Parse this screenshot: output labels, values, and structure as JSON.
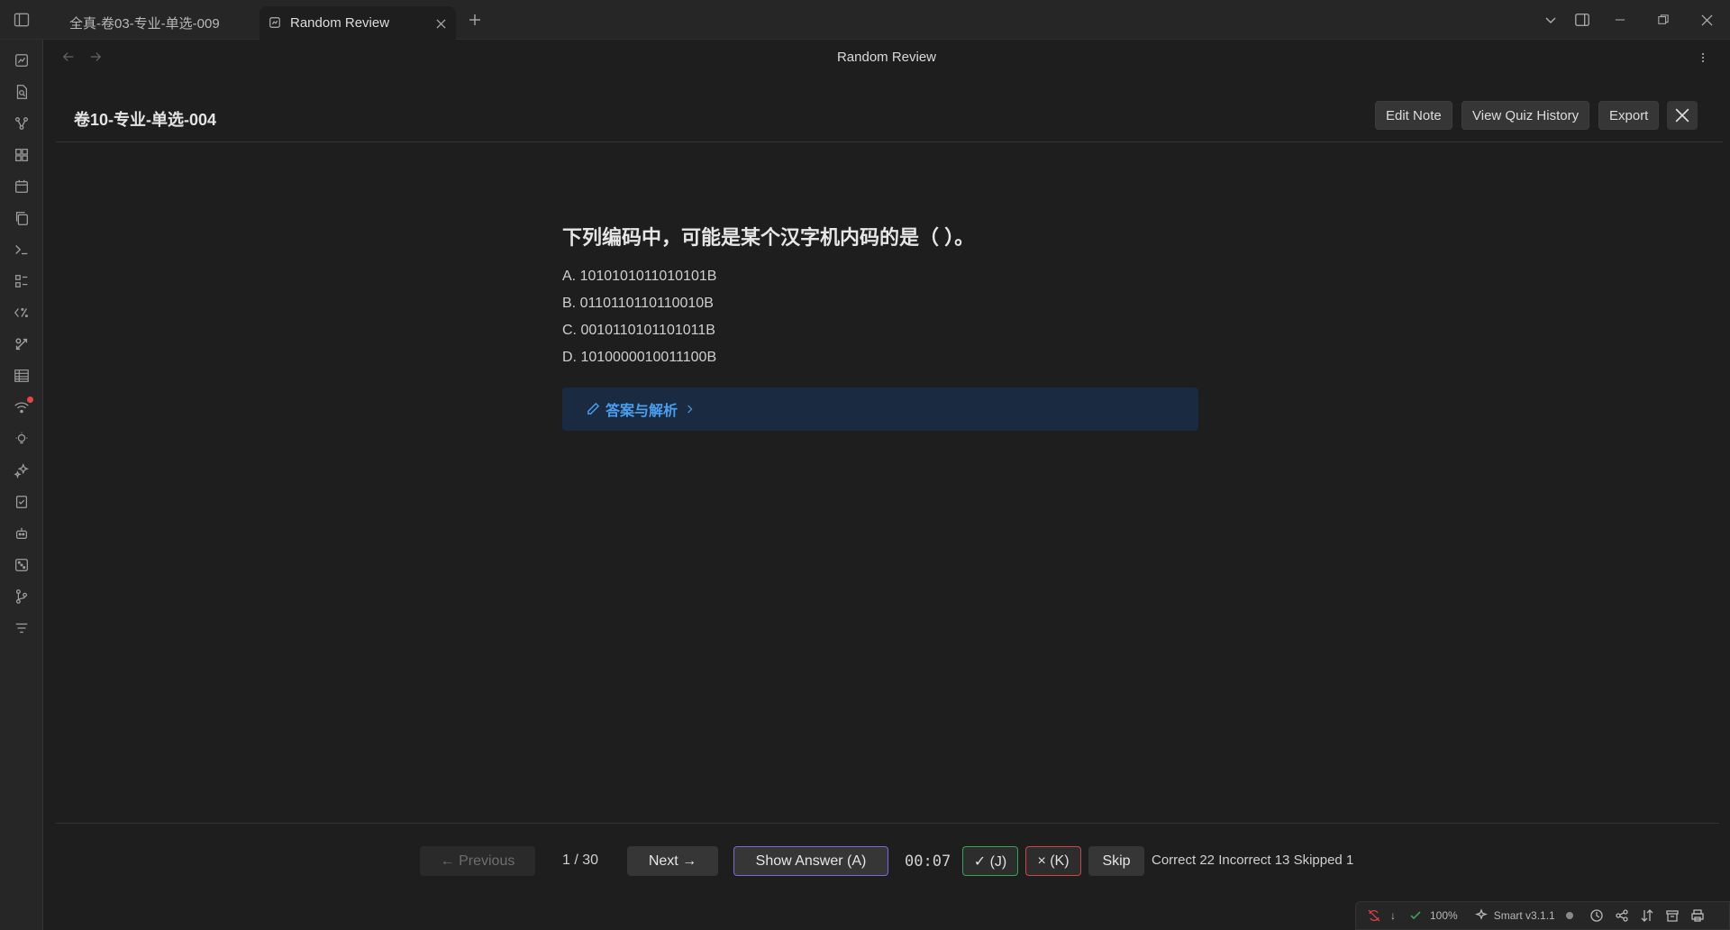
{
  "tabs": [
    {
      "label": "全真-卷03-专业-单选-009"
    },
    {
      "label": "Random Review"
    }
  ],
  "view": {
    "title": "Random Review"
  },
  "quiz": {
    "note_title": "卷10-专业-单选-004",
    "buttons": {
      "edit": "Edit Note",
      "history": "View Quiz History",
      "export": "Export"
    },
    "question": "下列编码中，可能是某个汉字机内码的是（ ）。",
    "options": [
      "A. 1010101011010101B",
      "B. 0110110110110010B",
      "C. 0010110101101011B",
      "D. 1010000010011100B"
    ],
    "answer_label": "答案与解析"
  },
  "footer": {
    "previous": "← Previous",
    "pager": "1 / 30",
    "next": "Next →",
    "show_answer": "Show Answer (A)",
    "timer": "00:07",
    "correct_btn": "✓ (J)",
    "incorrect_btn": "× (K)",
    "skip": "Skip",
    "stats": "Correct 22 Incorrect 13 Skipped 1"
  },
  "statusbar": {
    "down_arrow": "↓",
    "zoom": "100%",
    "plugin": "Smart v3.1.1"
  },
  "colors": {
    "background": "#1e1e1e",
    "accent_blue": "#4a9ef0",
    "correct_green": "#3aa15a",
    "incorrect_red": "#d0434a",
    "show_answer_border": "#7a6ad8"
  }
}
